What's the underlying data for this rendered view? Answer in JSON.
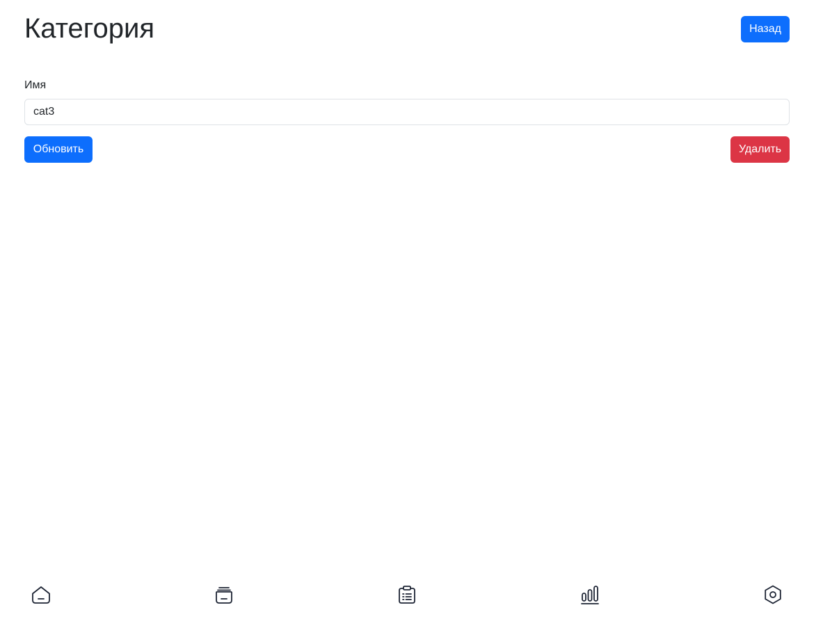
{
  "header": {
    "title": "Категория",
    "back_label": "Назад"
  },
  "form": {
    "name_label": "Имя",
    "name_value": "cat3",
    "update_label": "Обновить",
    "delete_label": "Удалить"
  },
  "bottom_nav": {
    "items": [
      {
        "icon": "home-icon"
      },
      {
        "icon": "wallet-icon"
      },
      {
        "icon": "clipboard-list-icon"
      },
      {
        "icon": "bar-chart-icon"
      },
      {
        "icon": "settings-icon"
      }
    ]
  },
  "colors": {
    "primary": "#0d6efd",
    "danger": "#dc3545",
    "text": "#212529",
    "icon": "#1c2333"
  }
}
